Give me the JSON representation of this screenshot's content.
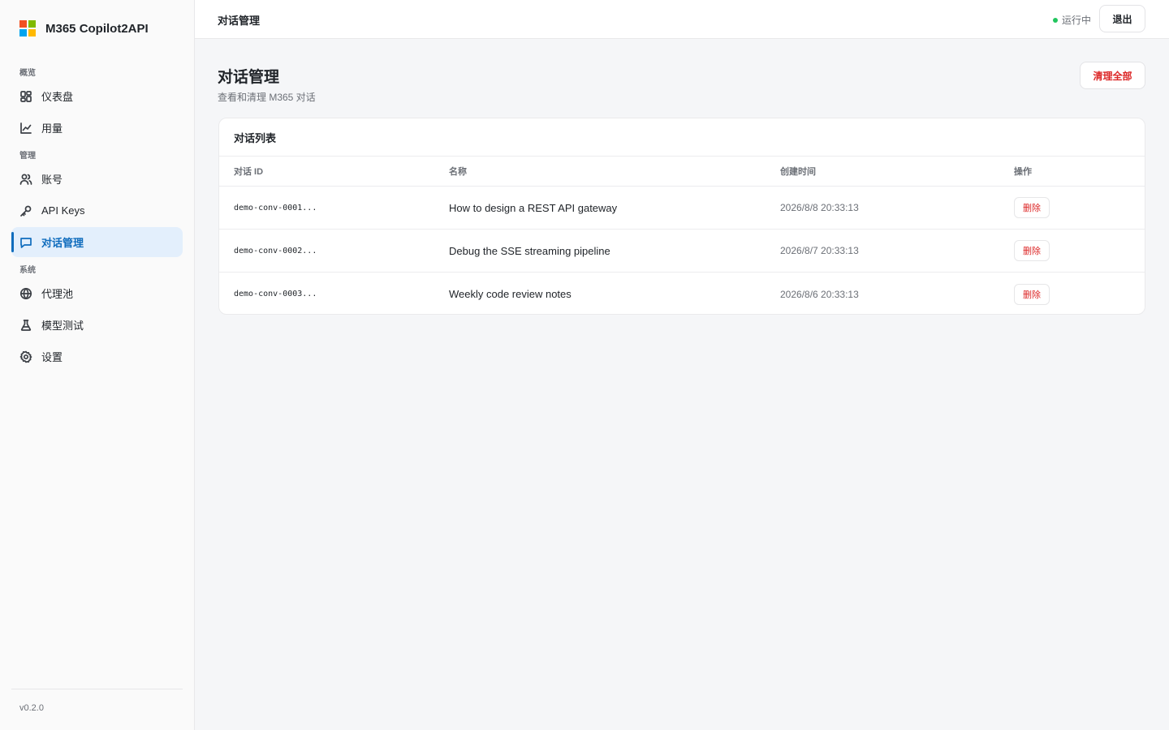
{
  "app": {
    "name": "M365 Copilot2API",
    "version": "v0.2.0"
  },
  "sidebar": {
    "sections": [
      {
        "label": "概览",
        "items": [
          {
            "label": "仪表盘",
            "icon": "dashboard-icon"
          },
          {
            "label": "用量",
            "icon": "chart-line-icon"
          }
        ]
      },
      {
        "label": "管理",
        "items": [
          {
            "label": "账号",
            "icon": "users-icon"
          },
          {
            "label": "API Keys",
            "icon": "key-icon"
          },
          {
            "label": "对话管理",
            "icon": "message-icon",
            "active": true
          }
        ]
      },
      {
        "label": "系统",
        "items": [
          {
            "label": "代理池",
            "icon": "globe-icon"
          },
          {
            "label": "模型测试",
            "icon": "flask-icon"
          },
          {
            "label": "设置",
            "icon": "gear-icon"
          }
        ]
      }
    ]
  },
  "topbar": {
    "title": "对话管理",
    "status": "运行中",
    "status_color": "#22c55e",
    "logout_label": "退出"
  },
  "page": {
    "title": "对话管理",
    "subtitle": "查看和清理 M365 对话",
    "clear_all_label": "清理全部"
  },
  "table": {
    "title": "对话列表",
    "headers": [
      "对话 ID",
      "名称",
      "创建时间",
      "操作"
    ],
    "rows": [
      {
        "id": "demo-conv-0001...",
        "name": "How to design a REST API gateway",
        "created": "2026/8/8 20:33:13",
        "action": "删除"
      },
      {
        "id": "demo-conv-0002...",
        "name": "Debug the SSE streaming pipeline",
        "created": "2026/8/7 20:33:13",
        "action": "删除"
      },
      {
        "id": "demo-conv-0003...",
        "name": "Weekly code review notes",
        "created": "2026/8/6 20:33:13",
        "action": "删除"
      }
    ]
  },
  "colors": {
    "accent": "#0f6cbd",
    "danger": "#dc2626"
  }
}
